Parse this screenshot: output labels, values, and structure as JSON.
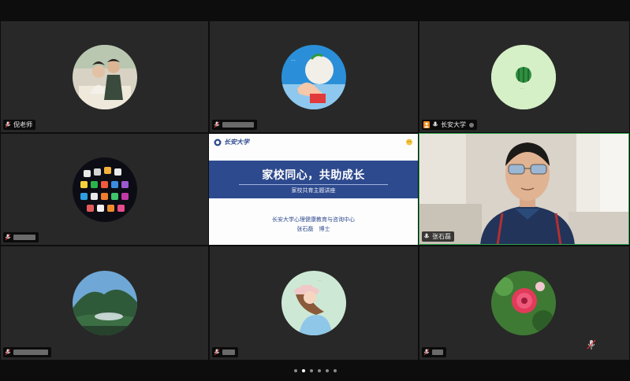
{
  "participants": {
    "tile1": {
      "name": "倪老师"
    },
    "tile3": {
      "name": "长安大学"
    },
    "tile6": {
      "name": "张石磊"
    }
  },
  "slide": {
    "logo_text": "长安大学",
    "title": "家校同心，共助成长",
    "subtitle": "家校共育主题讲座",
    "org": "长安大学心理健康教育与咨询中心",
    "author": "张石磊　博士"
  },
  "pagination": {
    "pages": 6,
    "current": 2
  },
  "colors": {
    "tile_bg": "#282828",
    "active_border": "#2ea44f",
    "slide_banner": "#2e4a8e"
  }
}
